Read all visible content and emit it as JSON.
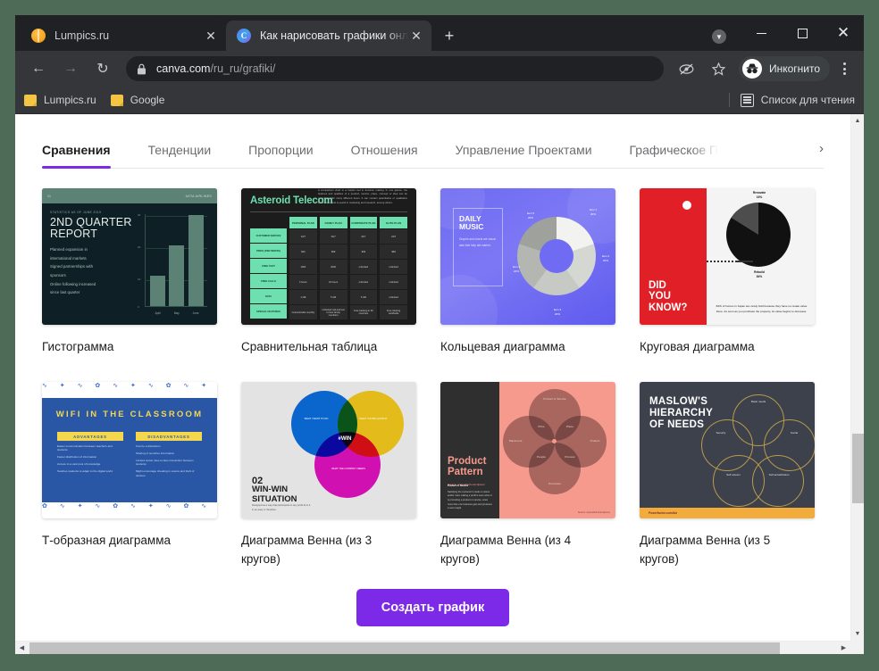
{
  "window": {
    "minimize_label": "Свернуть",
    "maximize_label": "Развернуть",
    "close_label": "Закрыть"
  },
  "tabs": [
    {
      "title": "Lumpics.ru",
      "favicon": "orange-circle-icon",
      "active": false
    },
    {
      "title": "Как нарисовать графики онлайн",
      "favicon": "canva-c-icon",
      "active": true
    }
  ],
  "newtab_label": "+",
  "toolbar": {
    "back_icon": "arrow-left-icon",
    "forward_icon": "arrow-right-icon",
    "reload_icon": "reload-icon",
    "lock_icon": "lock-icon",
    "url_domain": "canva.com",
    "url_path": "/ru_ru/grafiki/",
    "view_site_information": "Сведения о сайте",
    "eye_icon": "eye-slash-icon",
    "star_icon": "star-icon",
    "incognito_label": "Инкогнито",
    "menu_icon": "kebab-menu-icon"
  },
  "bookmarks": {
    "items": [
      {
        "label": "Lumpics.ru",
        "icon": "folder-icon"
      },
      {
        "label": "Google",
        "icon": "folder-icon"
      }
    ],
    "reading_list_label": "Список для чтения",
    "reading_list_icon": "reading-list-icon"
  },
  "page": {
    "category_tabs": [
      {
        "label": "Сравнения",
        "active": true
      },
      {
        "label": "Тенденции",
        "active": false
      },
      {
        "label": "Пропорции",
        "active": false
      },
      {
        "label": "Отношения",
        "active": false
      },
      {
        "label": "Управление Проектами",
        "active": false
      },
      {
        "label": "Графическое П",
        "active": false
      }
    ],
    "tabs_next_icon": "chevron-right-icon",
    "cards": [
      {
        "label": "Гистограмма",
        "thumb": "bar-chart-thumbnail"
      },
      {
        "label": "Сравнительная таблица",
        "thumb": "comparison-table-thumbnail"
      },
      {
        "label": "Кольцевая диаграмма",
        "thumb": "donut-chart-thumbnail"
      },
      {
        "label": "Круговая диаграмма",
        "thumb": "pie-chart-thumbnail"
      },
      {
        "label": "Т-образная диаграмма",
        "thumb": "t-chart-thumbnail"
      },
      {
        "label": "Диаграмма Венна (из 3 кругов)",
        "thumb": "venn-3-thumbnail"
      },
      {
        "label": "Диаграмма Венна (из 4 кругов)",
        "thumb": "venn-4-thumbnail"
      },
      {
        "label": "Диаграмма Венна (из 5 кругов)",
        "thumb": "venn-5-thumbnail"
      }
    ],
    "cta_label": "Создать график",
    "accent_color": "#7d2ae8"
  },
  "thumb1": {
    "topbar_left": "11",
    "topbar_right": "ASTA AIRLINES",
    "kicker": "STATISTICS AS OF JUNE 2019",
    "title": "2ND QUARTER REPORT",
    "bullets": [
      "Planned expansion in",
      "international markets",
      "Signed partnerships with",
      "sponsors",
      "Online following increased",
      "since last quarter"
    ],
    "y_ticks": [
      "30",
      "20",
      "10",
      "0"
    ],
    "x_labels": [
      "April",
      "May",
      "June"
    ],
    "bar_values": [
      10,
      20,
      30
    ]
  },
  "thumb2": {
    "title": "Asteroid Telecom",
    "desc": "A comparison chart is a helpful tool in decision making. In one glance, the features and qualities of a product, service, place, concept or idea can be compared with many different items. It can contain quantitative or qualitative information, and is useful in marketing and research, among others.",
    "row_headers": [
      "CUSTOMER SERVICE",
      "PRICE (PER MONTH)",
      "FREE TEXT",
      "FREE CALLS",
      "DATA",
      "SPECIAL FEATURES"
    ],
    "col_headers": [
      "PERSONAL PLAN",
      "FAMILY PLAN",
      "CORPORATE PLAN",
      "ELITE PLAN"
    ],
    "cells": [
      [
        "24/7",
        "24/7",
        "24/7",
        "24/7"
      ],
      [
        "$20",
        "$99",
        "$49",
        "$69"
      ],
      [
        "1000",
        "2000",
        "unlimited",
        "unlimited"
      ],
      [
        "4 hours",
        "10 hours",
        "unlimited",
        "unlimited"
      ],
      [
        "1 GB",
        "5 GB",
        "5 GB",
        "unlimited"
      ],
      [
        "Customizable monthly",
        "Unlimited call and text to host family members",
        "Free tracking in 40 countries",
        "Free tracking worldwide"
      ]
    ]
  },
  "thumb3": {
    "title": "DAILY MUSIC",
    "desc": "Graphs and charts are visual aids that help aid market.",
    "segments": [
      {
        "label": "Item 1",
        "value": "20%"
      },
      {
        "label": "Item 2",
        "value": "20%"
      },
      {
        "label": "Item 3",
        "value": "20%"
      },
      {
        "label": "Item 4",
        "value": "20%"
      },
      {
        "label": "Item 5",
        "value": "20%"
      }
    ]
  },
  "thumb4": {
    "headline": "DID YOU KNOW?",
    "slices": [
      {
        "label": "Renovate",
        "value": "16%"
      },
      {
        "label": "Rebuild",
        "value": "84%"
      }
    ],
    "caption": "84% of homes in Japan are newly built because they have no resale value there. As soon as you purchase the property, its value begins to decrease."
  },
  "thumb5": {
    "title": "WIFI IN THE CLASSROOM",
    "col1_header": "ADVANTAGES",
    "col1_items": [
      "Easier communication between teachers and students",
      "Faster distribution of information",
      "Access to a vast pool of knowledge",
      "Teaches students to adapt to the digital world"
    ],
    "col2_header": "DISADVANTAGES",
    "col2_items": [
      "Can be a distraction",
      "Sharing of sensitive information",
      "Limited social, face-to-face interaction between students",
      "Might encourage cheating in exams and theft of devices"
    ]
  },
  "thumb6": {
    "number": "02",
    "title": "WIN-WIN SITUATION",
    "subtitle": "Designed as a way that participants in any profit from it in an easy or therefore.",
    "center": "#WIN",
    "circles": [
      {
        "label": "WHAT I WANT TO DO"
      },
      {
        "label": "WHAT YOU'RE GOOD AT"
      },
      {
        "label": "WHAT THE COMPANY NEEDS"
      }
    ]
  },
  "thumb7": {
    "title": "Product Pattern",
    "subtitle": "Source: www.abell.lorem/ipsum",
    "body_heading": "Product or Service",
    "body_text": "Satisfying the customer's needs or wants and/or more making a profit is seen when it is promoting a product or service, since more than one business gets and produces a new insight.",
    "outer_labels": [
      "Product or Service",
      "Product",
      "Promotion",
      "Placement"
    ],
    "inner_labels": [
      "Price",
      "Place",
      "People",
      "Process"
    ],
    "source": "Source: www.abell.lorem/ipsum"
  },
  "thumb8": {
    "title": "MASLOW'S HIERARCHY OF NEEDS",
    "labels": [
      "Basic needs",
      "Security",
      "Social",
      "Self esteem",
      "Self-actualization"
    ],
    "footer": "Powerfactor.com/biz"
  }
}
